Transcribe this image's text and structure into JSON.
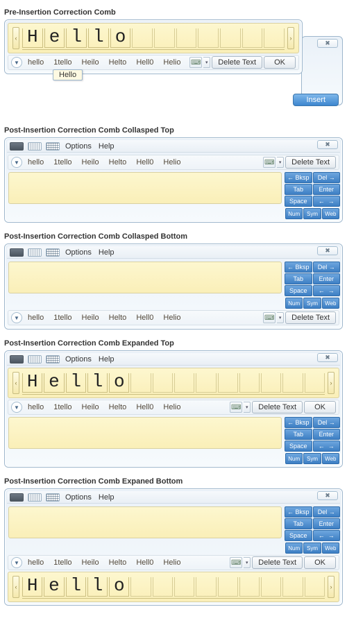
{
  "sections": {
    "s1": "Pre-Insertion Correction Comb",
    "s2": "Post-Insertion Correction Comb Collasped Top",
    "s3": "Post-Insertion Correction Comb Collasped Bottom",
    "s4": "Post-Insertion Correction Comb Expanded Top",
    "s5": "Post-Insertion Correction Comb Expaned Bottom"
  },
  "menu": {
    "options": "Options",
    "help": "Help"
  },
  "comb_letters": [
    "H",
    "e",
    "l",
    "l",
    "o"
  ],
  "suggestions": [
    "hello",
    "1tello",
    "Heilo",
    "Helto",
    "Hell0",
    "Helio"
  ],
  "tooltip_text": "Hello",
  "buttons": {
    "delete_text": "Delete Text",
    "ok": "OK",
    "insert": "Insert"
  },
  "close_glyph": "✖",
  "expand_glyph": "▼",
  "prev_glyph": "‹",
  "next_glyph": "›",
  "tool_glyph": "⌨",
  "keypad": {
    "bksp": "← Bksp",
    "del": "Del →",
    "tab": "Tab",
    "enter": "Enter",
    "space": "Space",
    "left": "←",
    "right": "→",
    "num": "Num",
    "sym": "Sym",
    "web": "Web"
  }
}
